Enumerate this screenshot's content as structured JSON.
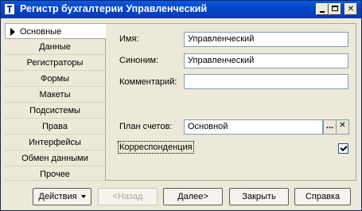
{
  "window": {
    "title": "Регистр бухгалтерии Управленческий",
    "close_glyph": "✕"
  },
  "tabs": [
    {
      "label": "Основные",
      "active": true
    },
    {
      "label": "Данные"
    },
    {
      "label": "Регистраторы"
    },
    {
      "label": "Формы"
    },
    {
      "label": "Макеты"
    },
    {
      "label": "Подсистемы"
    },
    {
      "label": "Права"
    },
    {
      "label": "Интерфейсы"
    },
    {
      "label": "Обмен данными"
    },
    {
      "label": "Прочее"
    }
  ],
  "form": {
    "name_label": "Имя:",
    "name_value": "Управленческий",
    "synonym_label": "Синоним:",
    "synonym_value": "Управленческий",
    "comment_label": "Комментарий:",
    "comment_value": "",
    "chart_of_accounts_label": "План счетов:",
    "chart_of_accounts_value": "Основной",
    "select_button_label": "...",
    "clear_button_label": "✕",
    "correspondence_label": "Корреспонденция",
    "correspondence_checked": true
  },
  "buttons": {
    "actions": "Действия",
    "back": "<Назад",
    "next": "Далее>",
    "close": "Закрыть",
    "help": "Справка"
  }
}
